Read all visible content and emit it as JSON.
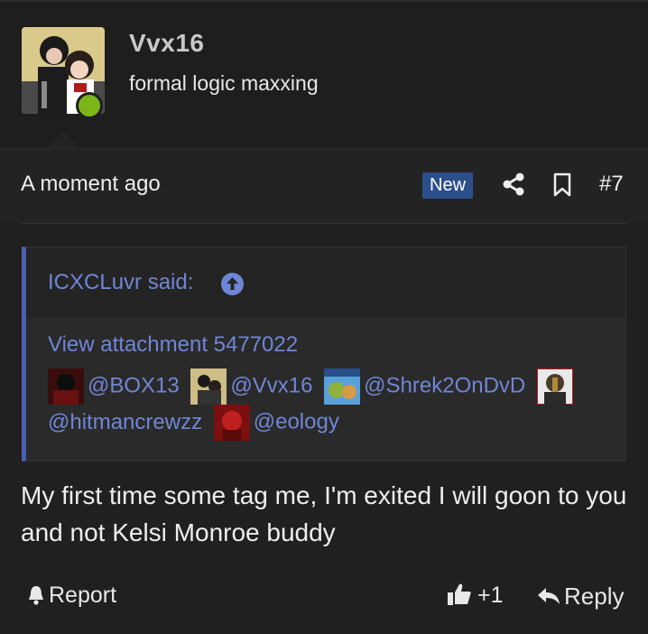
{
  "user": {
    "username": "Vvx16",
    "title": "formal logic maxxing",
    "avatar_icon": "user-avatar",
    "status_color": "#7cb518"
  },
  "meta": {
    "timestamp": "A moment ago",
    "new_badge": "New",
    "post_number": "#7",
    "share_icon": "share-icon",
    "bookmark_icon": "bookmark-icon"
  },
  "quote": {
    "author": "ICXCLuvr said:",
    "attachment": "View attachment 5477022",
    "mentions": [
      {
        "handle": "@BOX13"
      },
      {
        "handle": "@Vvx16"
      },
      {
        "handle": "@Shrek2OnDvD"
      },
      {
        "handle": "@hitmancrewzz"
      },
      {
        "handle": "@eology"
      }
    ]
  },
  "post": {
    "body": "My first time some tag me, I'm exited I will goon to you and not Kelsi Monroe buddy"
  },
  "footer": {
    "report": "Report",
    "like_count": "+1",
    "reply": "Reply"
  },
  "colors": {
    "accent": "#6f86d6",
    "badge": "#2b4f8a",
    "background": "#202020"
  }
}
